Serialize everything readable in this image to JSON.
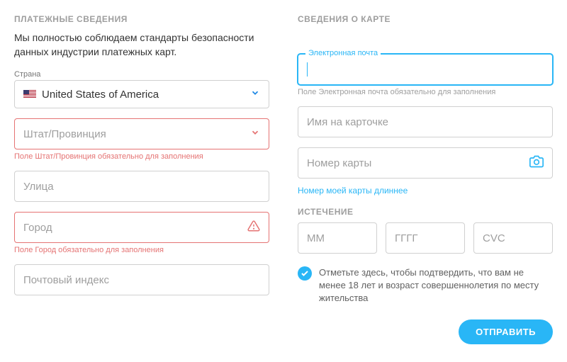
{
  "payment": {
    "title": "ПЛАТЕЖНЫЕ СВЕДЕНИЯ",
    "subtext": "Мы полностью соблюдаем стандарты безопасности данных индустрии платежных карт.",
    "country": {
      "label": "Страна",
      "value": "United States of America"
    },
    "state": {
      "placeholder": "Штат/Провинция",
      "error": "Поле Штат/Провинция обязательно для заполнения"
    },
    "street": {
      "placeholder": "Улица"
    },
    "city": {
      "placeholder": "Город",
      "error": "Поле Город обязательно для заполнения"
    },
    "zip": {
      "placeholder": "Почтовый индекс"
    }
  },
  "card": {
    "title": "СВЕДЕНИЯ О КАРТЕ",
    "email": {
      "label": "Электронная почта",
      "helper": "Поле Электронная почта обязательно для заполнения"
    },
    "name": {
      "placeholder": "Имя на карточке"
    },
    "number": {
      "placeholder": "Номер карты"
    },
    "longer_link": "Номер моей карты длиннее",
    "expiry": {
      "label": "ИСТЕЧЕНИЕ",
      "mm": "MM",
      "yyyy": "ГГГГ",
      "cvc": "CVC"
    },
    "confirm_text": "Отметьте здесь, чтобы подтвердить, что вам не менее 18 лет и возраст совершеннолетия по месту жительства",
    "submit": "ОТПРАВИТЬ"
  }
}
